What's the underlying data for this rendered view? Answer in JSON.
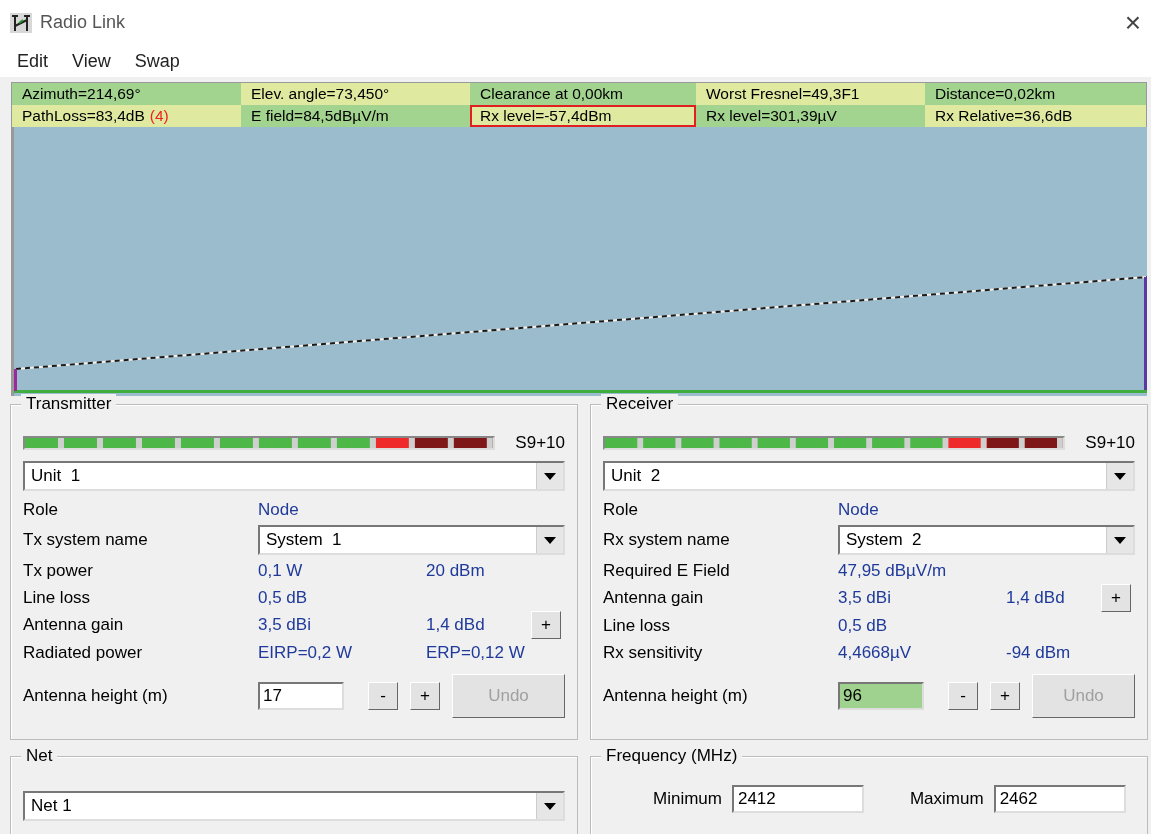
{
  "window": {
    "title": "Radio Link",
    "close": "×"
  },
  "menu": [
    {
      "label": "Edit"
    },
    {
      "label": "View"
    },
    {
      "label": "Swap"
    }
  ],
  "info_rows": [
    [
      {
        "text": "Azimuth=214,69°",
        "highlighted": false
      },
      {
        "text": "Elev. angle=73,450°",
        "highlighted": false
      },
      {
        "text": "Clearance at 0,00km",
        "highlighted": false
      },
      {
        "text": "Worst Fresnel=49,3F1",
        "highlighted": false
      },
      {
        "text": "Distance=0,02km",
        "highlighted": false
      }
    ],
    [
      {
        "text": "PathLoss=83,4dB",
        "note": "(4)",
        "highlighted": false
      },
      {
        "text": "E field=84,5dBµV/m",
        "highlighted": false
      },
      {
        "text": "Rx level=-57,4dBm",
        "highlighted": true
      },
      {
        "text": "Rx level=301,39µV",
        "highlighted": false
      },
      {
        "text": "Rx Relative=36,6dB",
        "highlighted": false
      }
    ]
  ],
  "panels": [
    {
      "title": "Transmitter",
      "meter": {
        "level": 1,
        "reading": "S9+10"
      },
      "unit": "Unit  1",
      "rows": [
        {
          "kind": "value",
          "label": "Role",
          "value": "Node"
        },
        {
          "kind": "combo",
          "label": "Tx system name",
          "value": "System  1"
        },
        {
          "kind": "value",
          "label": "Tx power",
          "value": "0,1 W",
          "value_2": "20 dBm"
        },
        {
          "kind": "value",
          "label": "Line loss",
          "value": "0,5 dB"
        },
        {
          "kind": "value",
          "label": "Antenna gain",
          "value": "3,5 dBi",
          "value_2": "1,4 dBd",
          "button": "+"
        },
        {
          "kind": "value",
          "label": "Radiated power",
          "value": "EIRP=0,2 W",
          "value_2": "ERP=0,12 W"
        }
      ],
      "height": {
        "label": "Antenna height (m)",
        "value": "17",
        "highlighted": false,
        "minus": "-",
        "plus": "+",
        "undo": "Undo",
        "disabled": true
      }
    },
    {
      "title": "Receiver",
      "meter": {
        "level": 1,
        "reading": "S9+10"
      },
      "unit": "Unit  2",
      "rows": [
        {
          "kind": "value",
          "label": "Role",
          "value": "Node"
        },
        {
          "kind": "combo",
          "label": "Rx system name",
          "value": "System  2"
        },
        {
          "kind": "value",
          "label": "Required E Field",
          "value": "47,95 dBµV/m"
        },
        {
          "kind": "value",
          "label": "Antenna gain",
          "value": "3,5 dBi",
          "value_2": "1,4 dBd",
          "button": "+"
        },
        {
          "kind": "value",
          "label": "Line loss",
          "value": "0,5 dB"
        },
        {
          "kind": "value",
          "label": "Rx sensitivity",
          "value": "4,4668µV",
          "value_2": "-94 dBm"
        }
      ],
      "height": {
        "label": "Antenna height (m)",
        "value": "96",
        "highlighted": true,
        "minus": "-",
        "plus": "+",
        "undo": "Undo",
        "disabled": true
      }
    }
  ],
  "net": {
    "title": "Net",
    "value": "Net 1"
  },
  "frequency": {
    "title": "Frequency (MHz)",
    "minimum_label": "Minimum",
    "minimum": "2412",
    "maximum_label": "Maximum",
    "maximum": "2462"
  }
}
